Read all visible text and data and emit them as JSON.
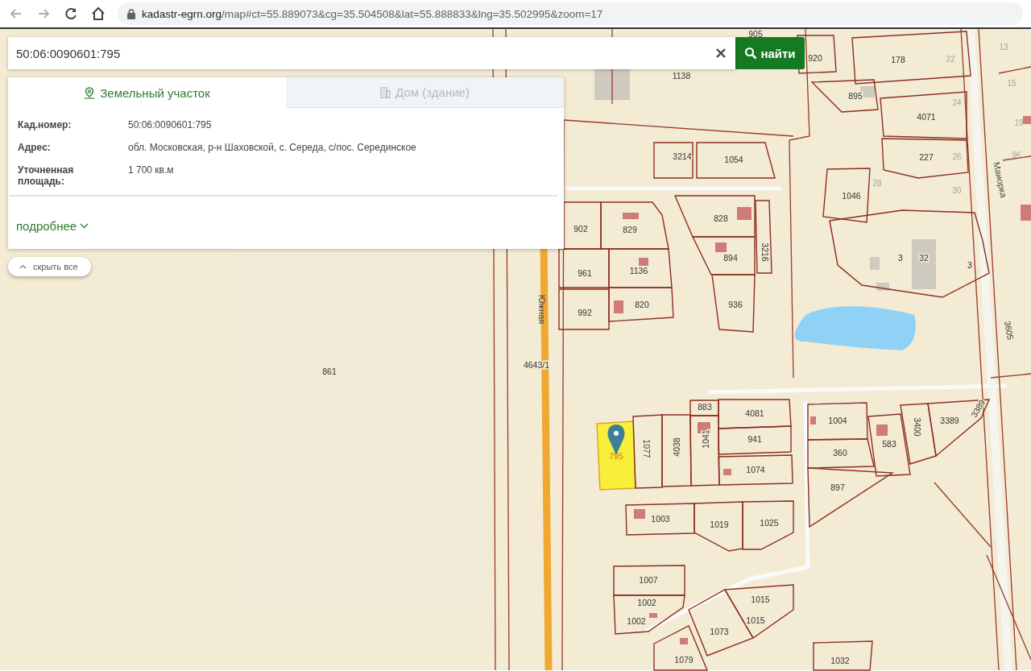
{
  "browser": {
    "url_host": "kadastr-egrn.org",
    "url_rest": "/map#ct=55.889073&cg=35.504508&lat=55.888833&lng=35.502995&zoom=17"
  },
  "search": {
    "value": "50:06:0090601:795",
    "button": "найти"
  },
  "info_panel": {
    "tabs": [
      {
        "label": "Земельный участок",
        "kind": "land",
        "selected": true
      },
      {
        "label": "Дом (здание)",
        "kind": "building",
        "selected": false
      }
    ],
    "fields": [
      {
        "label": "Кад.номер:",
        "value": "50:06:0090601:795"
      },
      {
        "label": "Адрес:",
        "value": "обл. Московская, р-н Шаховской, с. Середа, с/пос. Серединское"
      },
      {
        "label": "Уточненная площадь:",
        "value": "1 700 кв.м"
      }
    ],
    "more_link": "подробнее"
  },
  "hide_all": "скрыть все",
  "map": {
    "streets": [
      {
        "label": "Южная"
      },
      {
        "label": "Маиорка"
      }
    ],
    "house_numbers": [
      {
        "label": "13"
      },
      {
        "label": "15"
      },
      {
        "label": "22"
      },
      {
        "label": "24"
      },
      {
        "label": "26"
      },
      {
        "label": "28"
      },
      {
        "label": "30"
      },
      {
        "label": "19"
      },
      {
        "label": "96"
      }
    ],
    "parcels": [
      {
        "label": "1138",
        "selected": false
      },
      {
        "label": "905",
        "selected": false
      },
      {
        "label": "920",
        "selected": false
      },
      {
        "label": "178",
        "selected": false
      },
      {
        "label": "895",
        "selected": false
      },
      {
        "label": "4071",
        "selected": false
      },
      {
        "label": "227",
        "selected": false
      },
      {
        "label": "1046",
        "selected": false
      },
      {
        "label": "3214",
        "selected": false
      },
      {
        "label": "1054",
        "selected": false
      },
      {
        "label": "902",
        "selected": false
      },
      {
        "label": "829",
        "selected": false
      },
      {
        "label": "828",
        "selected": false
      },
      {
        "label": "894",
        "selected": false
      },
      {
        "label": "3216",
        "selected": false
      },
      {
        "label": "961",
        "selected": false
      },
      {
        "label": "1136",
        "selected": false
      },
      {
        "label": "992",
        "selected": false
      },
      {
        "label": "820",
        "selected": false
      },
      {
        "label": "936",
        "selected": false
      },
      {
        "label": "3",
        "selected": false
      },
      {
        "label": "32",
        "selected": false
      },
      {
        "label": "3",
        "selected": false
      },
      {
        "label": "861",
        "selected": false
      },
      {
        "label": "4643/1",
        "selected": false
      },
      {
        "label": "3605",
        "selected": false
      },
      {
        "label": "795",
        "selected": true
      },
      {
        "label": "1077",
        "selected": false
      },
      {
        "label": "4038",
        "selected": false
      },
      {
        "label": "883",
        "selected": false
      },
      {
        "label": "1041",
        "selected": false
      },
      {
        "label": "4081",
        "selected": false
      },
      {
        "label": "941",
        "selected": false
      },
      {
        "label": "1074",
        "selected": false
      },
      {
        "label": "1004",
        "selected": false
      },
      {
        "label": "360",
        "selected": false
      },
      {
        "label": "897",
        "selected": false
      },
      {
        "label": "583",
        "selected": false
      },
      {
        "label": "3400",
        "selected": false
      },
      {
        "label": "3389",
        "selected": false
      },
      {
        "label": "3389",
        "selected": false
      },
      {
        "label": "1003",
        "selected": false
      },
      {
        "label": "1019",
        "selected": false
      },
      {
        "label": "1025",
        "selected": false
      },
      {
        "label": "1007",
        "selected": false
      },
      {
        "label": "1002",
        "selected": false
      },
      {
        "label": "1002",
        "selected": false
      },
      {
        "label": "1015",
        "selected": false
      },
      {
        "label": "1015",
        "selected": false
      },
      {
        "label": "1073",
        "selected": false
      },
      {
        "label": "1079",
        "selected": false
      },
      {
        "label": "1032",
        "selected": false
      }
    ]
  }
}
